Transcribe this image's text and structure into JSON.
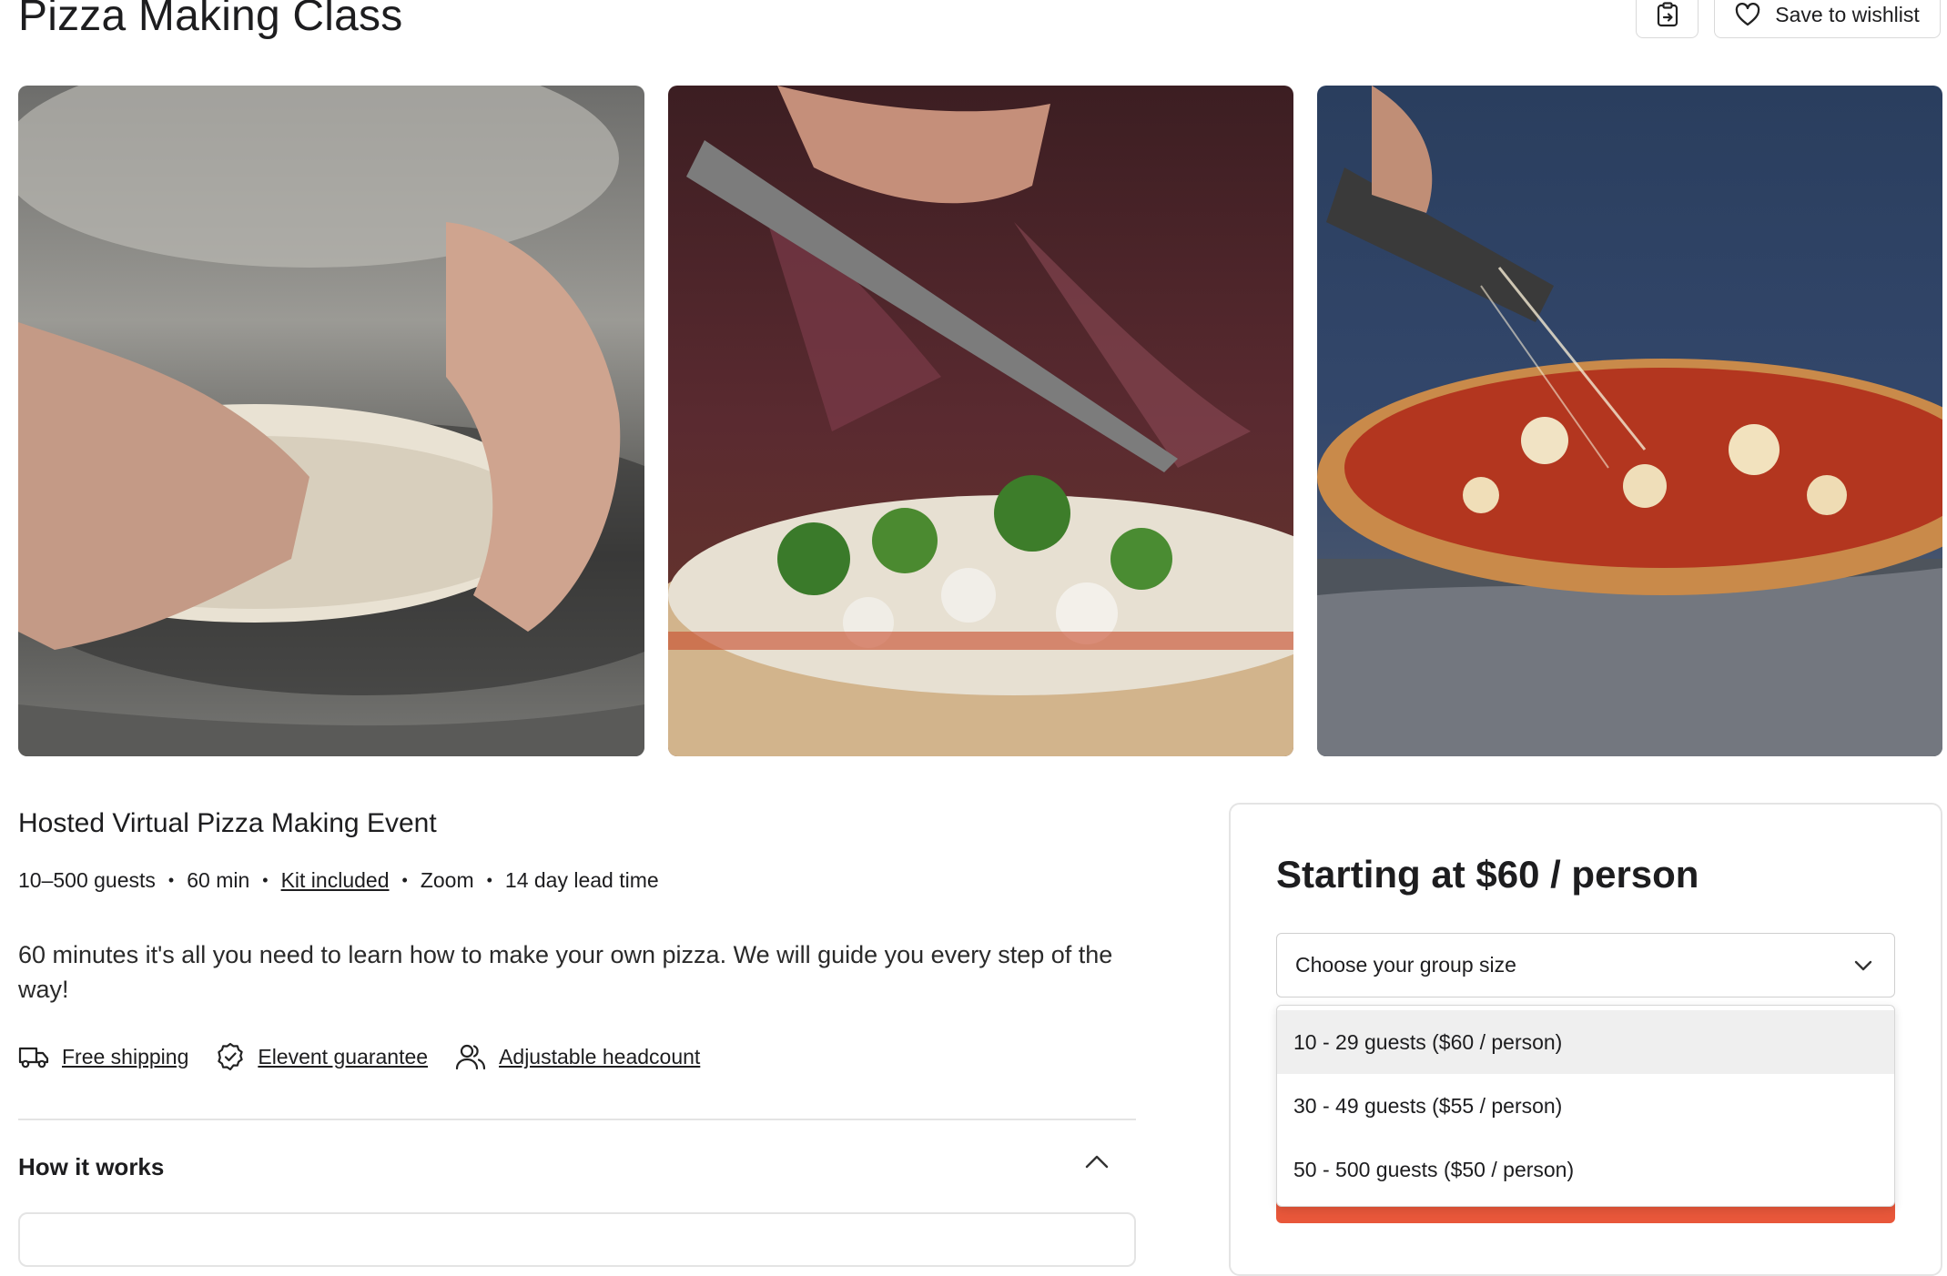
{
  "page": {
    "title": "Pizza Making Class",
    "wishlist_label": "Save to wishlist"
  },
  "gallery": [
    {
      "alt": "hands stretching pizza dough"
    },
    {
      "alt": "knife sprinkling herbs over vegetable pizza"
    },
    {
      "alt": "cutting a cheese pizza slice"
    }
  ],
  "event": {
    "subtitle": "Hosted Virtual Pizza Making Event",
    "meta": [
      "10–500 guests",
      "60 min",
      "Kit included",
      "Zoom",
      "14 day lead time"
    ],
    "separator": "•",
    "description": "60 minutes it's all you need to learn how to make your own pizza. We will guide you every step of the way!",
    "features": [
      {
        "label": "Free shipping",
        "icon": "truck-icon"
      },
      {
        "label": "Elevent guarantee",
        "icon": "check-badge-icon"
      },
      {
        "label": "Adjustable headcount",
        "icon": "users-icon"
      }
    ],
    "how_it_works": "How it works"
  },
  "booking": {
    "price_heading": "Starting at $60 / person",
    "select_placeholder": "Choose your group size",
    "options": [
      "10 - 29 guests ($60 / person)",
      "30 - 49 guests ($55 / person)",
      "50 - 500 guests ($50 / person)"
    ],
    "highlighted_option_index": 0
  },
  "colors": {
    "accent": "#e8573a",
    "border": "#d9d9d9",
    "text": "#1d1d1f"
  }
}
